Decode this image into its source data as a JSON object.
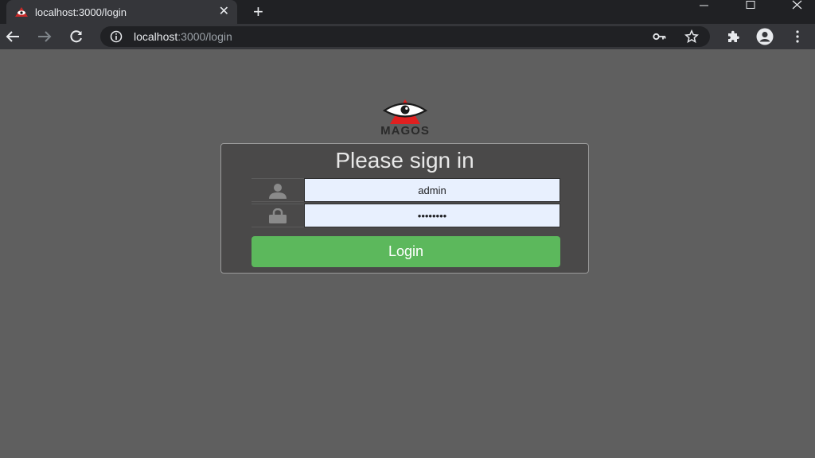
{
  "browser": {
    "tab": {
      "title": "localhost:3000/login"
    },
    "url": {
      "host": "localhost",
      "rest": ":3000/login"
    }
  },
  "page": {
    "logo_text": "MAGOS",
    "title": "Please sign in",
    "username": {
      "value": "admin"
    },
    "password": {
      "value": "••••••••"
    },
    "login_label": "Login"
  },
  "colors": {
    "page_background": "#5f5f5f",
    "card_background": "#4a4949",
    "login_button": "#5cb85c",
    "autofill_input": "#e8f0fe",
    "logo_red": "#e02020"
  }
}
